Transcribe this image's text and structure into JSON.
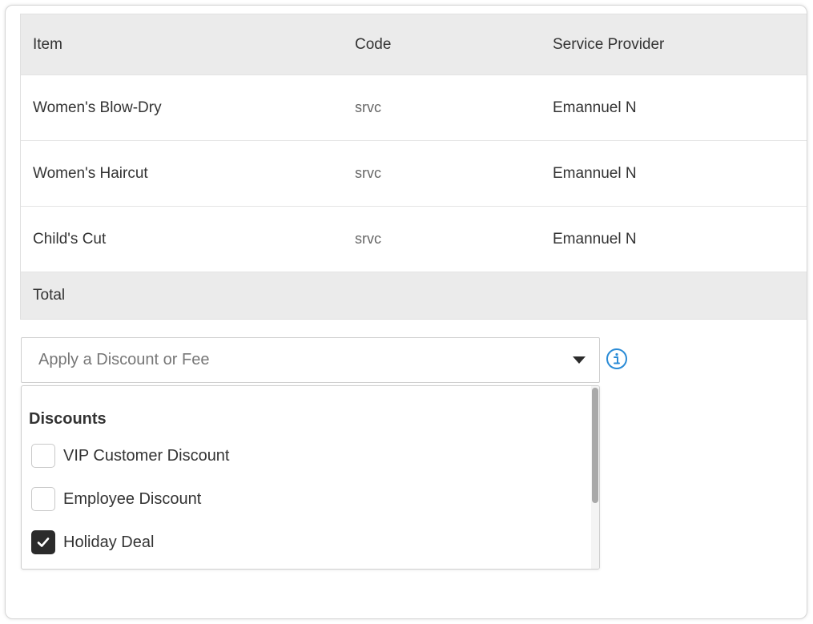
{
  "table": {
    "headers": {
      "item": "Item",
      "code": "Code",
      "provider": "Service Provider"
    },
    "rows": [
      {
        "item": "Women's Blow-Dry",
        "code": "srvc",
        "provider": "Emannuel N"
      },
      {
        "item": "Women's Haircut",
        "code": "srvc",
        "provider": "Emannuel N"
      },
      {
        "item": "Child's Cut",
        "code": "srvc",
        "provider": "Emannuel N"
      }
    ],
    "total_label": "Total"
  },
  "discount_select": {
    "placeholder": "Apply a Discount or Fee",
    "info_icon": "info-circle-icon"
  },
  "dropdown": {
    "group_title": "Discounts",
    "options": [
      {
        "label": "VIP Customer Discount",
        "checked": false
      },
      {
        "label": "Employee Discount",
        "checked": false
      },
      {
        "label": "Holiday Deal",
        "checked": true
      }
    ]
  },
  "colors": {
    "header_bg": "#ebebeb",
    "text": "#333333",
    "info_accent": "#2a8bd6",
    "checked_bg": "#2b2b2b"
  }
}
